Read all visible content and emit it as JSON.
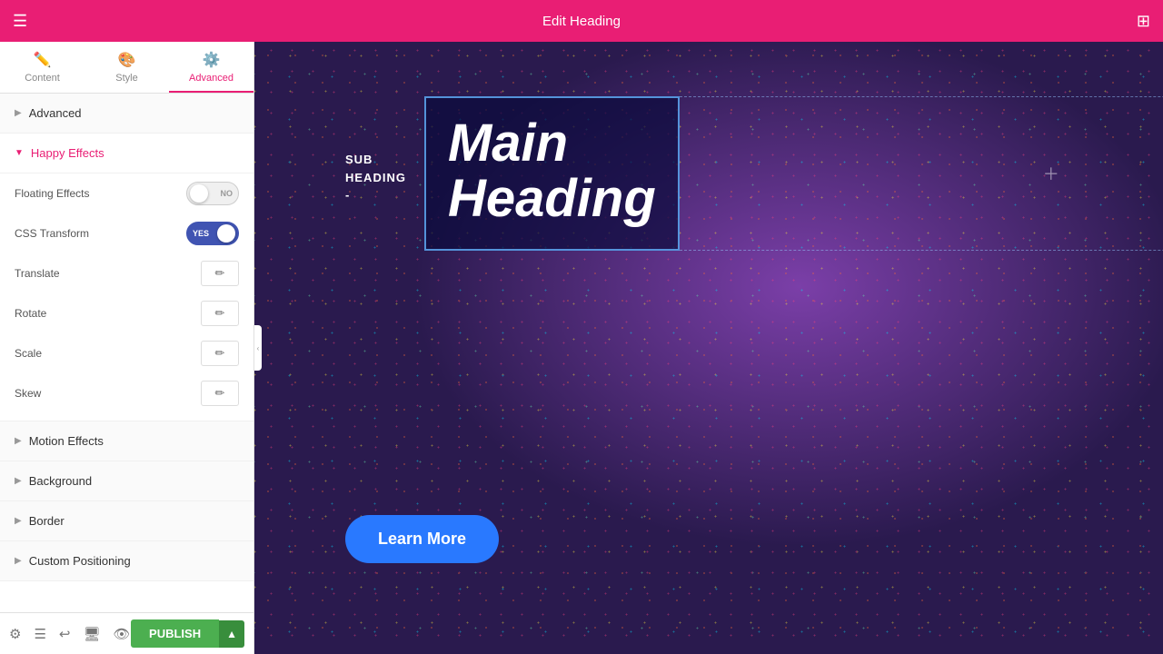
{
  "topbar": {
    "title": "Edit Heading",
    "menu_icon": "☰",
    "grid_icon": "⊞"
  },
  "tabs": [
    {
      "id": "content",
      "label": "Content",
      "icon": "✏️"
    },
    {
      "id": "style",
      "label": "Style",
      "icon": "🎨"
    },
    {
      "id": "advanced",
      "label": "Advanced",
      "icon": "⚙️"
    }
  ],
  "sidebar": {
    "sections": [
      {
        "id": "advanced",
        "label": "Advanced",
        "expanded": false
      },
      {
        "id": "happy-effects",
        "label": "Happy Effects",
        "expanded": true
      },
      {
        "id": "motion-effects",
        "label": "Motion Effects",
        "expanded": false
      },
      {
        "id": "background",
        "label": "Background",
        "expanded": false
      },
      {
        "id": "border",
        "label": "Border",
        "expanded": false
      },
      {
        "id": "custom-positioning",
        "label": "Custom Positioning",
        "expanded": false
      }
    ],
    "happy_effects": {
      "floating_effects": {
        "label": "Floating Effects",
        "value": "no",
        "state": "off"
      },
      "css_transform": {
        "label": "CSS Transform",
        "value": "yes",
        "state": "on"
      },
      "translate": {
        "label": "Translate",
        "edit_icon": "✏"
      },
      "rotate": {
        "label": "Rotate",
        "edit_icon": "✏"
      },
      "scale": {
        "label": "Scale",
        "edit_icon": "✏"
      },
      "skew": {
        "label": "Skew",
        "edit_icon": "✏"
      }
    }
  },
  "canvas": {
    "sub_heading": "SUB\nHEADING\n-",
    "main_heading": "Main\nHeading",
    "learn_more": "Learn More"
  },
  "bottombar": {
    "icons": [
      "⚙",
      "☰",
      "↩",
      "🖥",
      "👁"
    ],
    "publish_label": "PUBLISH",
    "publish_arrow": "▲"
  }
}
